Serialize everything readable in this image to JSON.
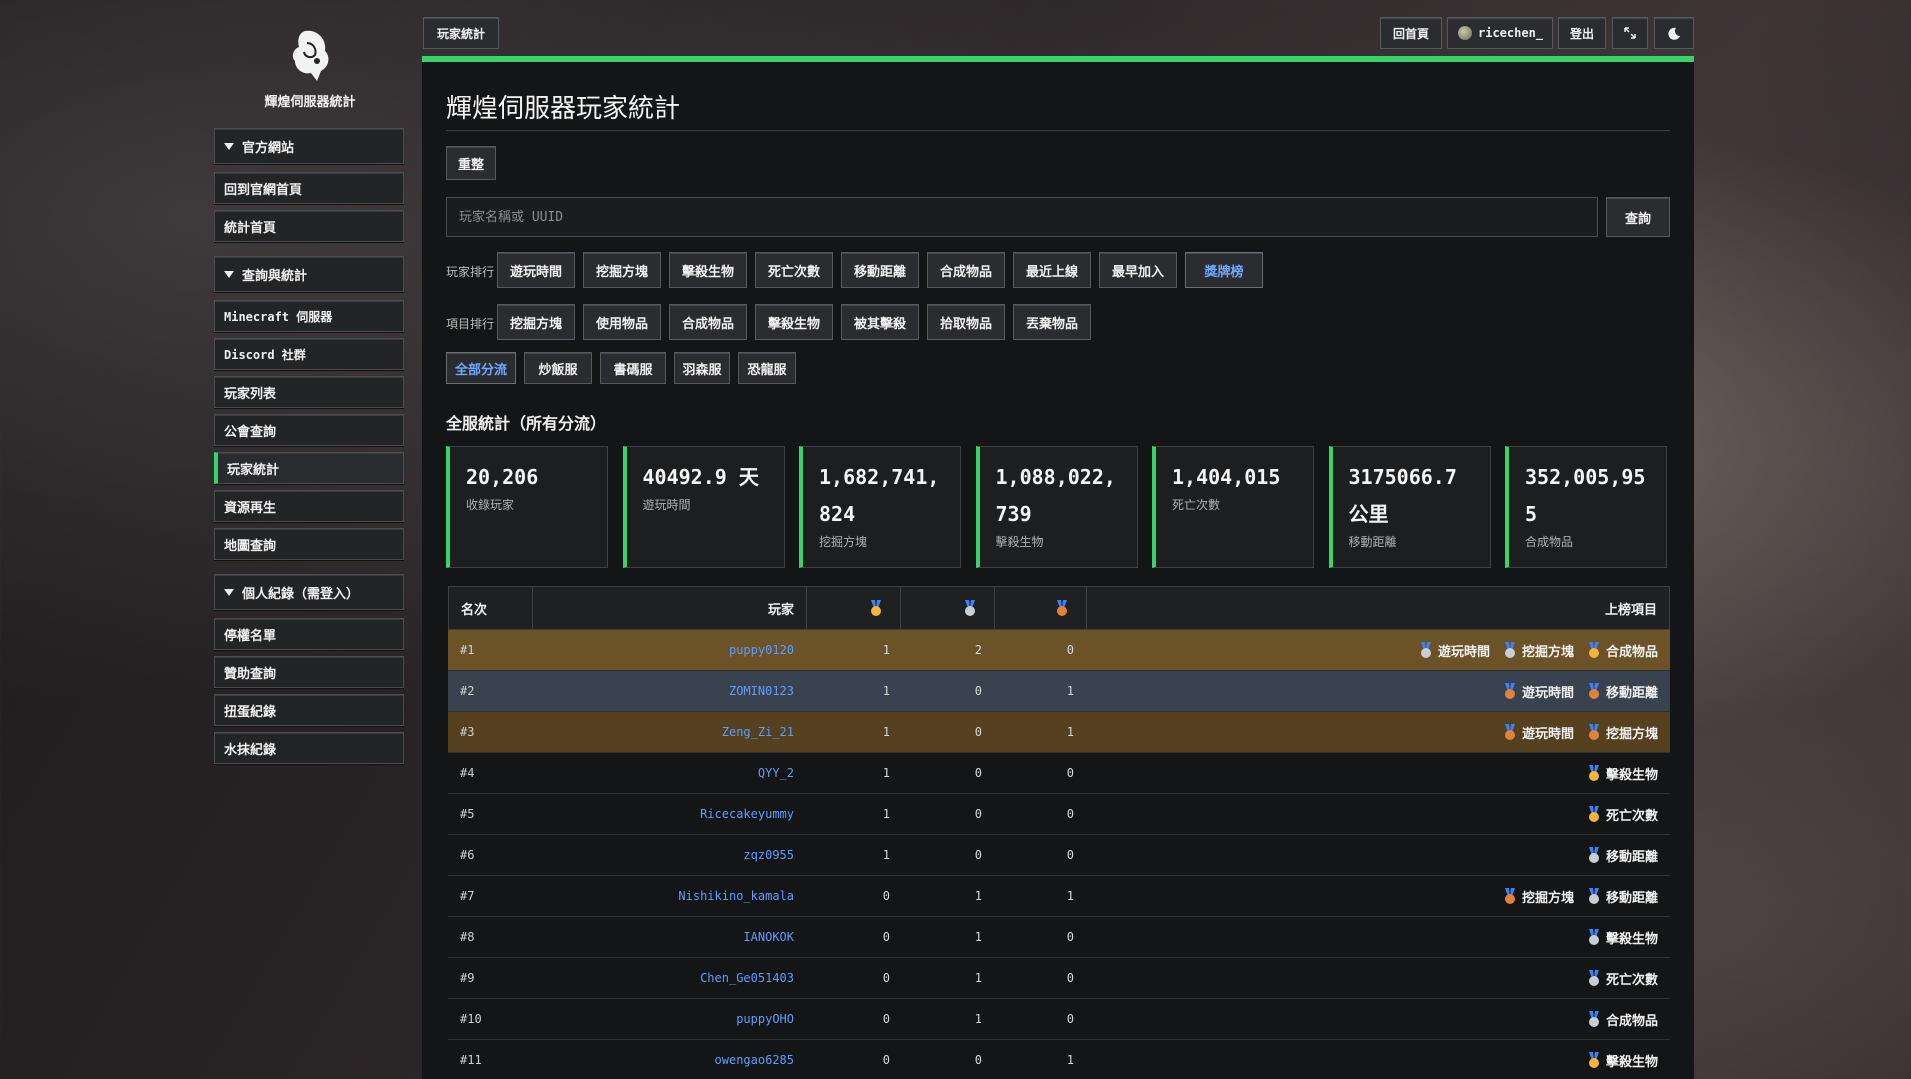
{
  "sidebar": {
    "logo_text": "輝煌伺服器統計",
    "groups": [
      {
        "title": "官方網站",
        "items": [
          "回到官網首頁",
          "統計首頁"
        ]
      },
      {
        "title": "查詢與統計",
        "items": [
          "Minecraft 伺服器",
          "Discord 社群",
          "玩家列表",
          "公會查詢",
          "玩家統計",
          "資源再生",
          "地圖查詢"
        ]
      },
      {
        "title": "個人紀錄（需登入）",
        "items": [
          "停權名單",
          "贊助查詢",
          "扭蛋紀錄",
          "水抹紀錄"
        ]
      }
    ]
  },
  "topbar": {
    "page_tab": "玩家統計",
    "home": "回首頁",
    "user": "ricechen_",
    "logout": "登出",
    "expand_icon": "expand-icon",
    "theme_icon": "moon-icon"
  },
  "main": {
    "title": "輝煌伺服器玩家統計",
    "reset": "重整",
    "search_placeholder": "玩家名稱或 UUID",
    "search_button": "查詢",
    "player_rank_label": "玩家排行",
    "player_rank_tabs": [
      "遊玩時間",
      "挖掘方塊",
      "擊殺生物",
      "死亡次數",
      "移動距離",
      "合成物品",
      "最近上線",
      "最早加入",
      "獎牌榜"
    ],
    "player_rank_selected": "獎牌榜",
    "item_rank_label": "項目排行",
    "item_rank_tabs": [
      "挖掘方塊",
      "使用物品",
      "合成物品",
      "擊殺生物",
      "被其擊殺",
      "拾取物品",
      "丟棄物品"
    ],
    "server_tabs": [
      "全部分流",
      "炒飯服",
      "書碼服",
      "羽森服",
      "恐龍服"
    ],
    "server_selected": "全部分流",
    "section_title": "全服統計（所有分流）",
    "stats": [
      {
        "value": "20,206",
        "label": "收錄玩家"
      },
      {
        "value": "40492.9 天",
        "label": "遊玩時間"
      },
      {
        "value": "1,682,741,824",
        "label": "挖掘方塊"
      },
      {
        "value": "1,088,022,739",
        "label": "擊殺生物"
      },
      {
        "value": "1,404,015",
        "label": "死亡次數"
      },
      {
        "value": "3175066.7 公里",
        "label": "移動距離"
      },
      {
        "value": "352,005,955",
        "label": "合成物品"
      }
    ],
    "table": {
      "headers": {
        "rank": "名次",
        "player": "玩家",
        "items": "上榜項目"
      },
      "rows": [
        {
          "rank": "#1",
          "player": "puppy0120",
          "gold": "1",
          "silver": "2",
          "bronze": "0",
          "tags": [
            {
              "m": "s",
              "t": "遊玩時間"
            },
            {
              "m": "s",
              "t": "挖掘方塊"
            },
            {
              "m": "g",
              "t": "合成物品"
            }
          ]
        },
        {
          "rank": "#2",
          "player": "ZOMIN0123",
          "gold": "1",
          "silver": "0",
          "bronze": "1",
          "tags": [
            {
              "m": "b",
              "t": "遊玩時間"
            },
            {
              "m": "b",
              "t": "移動距離"
            }
          ]
        },
        {
          "rank": "#3",
          "player": "Zeng_Zi_21",
          "gold": "1",
          "silver": "0",
          "bronze": "1",
          "tags": [
            {
              "m": "b",
              "t": "遊玩時間"
            },
            {
              "m": "b",
              "t": "挖掘方塊"
            }
          ]
        },
        {
          "rank": "#4",
          "player": "QYY_2",
          "gold": "1",
          "silver": "0",
          "bronze": "0",
          "tags": [
            {
              "m": "g",
              "t": "擊殺生物"
            }
          ]
        },
        {
          "rank": "#5",
          "player": "Ricecakeyummy",
          "gold": "1",
          "silver": "0",
          "bronze": "0",
          "tags": [
            {
              "m": "g",
              "t": "死亡次數"
            }
          ]
        },
        {
          "rank": "#6",
          "player": "zqz0955",
          "gold": "1",
          "silver": "0",
          "bronze": "0",
          "tags": [
            {
              "m": "s",
              "t": "移動距離"
            }
          ]
        },
        {
          "rank": "#7",
          "player": "Nishikino_kamala",
          "gold": "0",
          "silver": "1",
          "bronze": "1",
          "tags": [
            {
              "m": "b",
              "t": "挖掘方塊"
            },
            {
              "m": "s",
              "t": "移動距離"
            }
          ]
        },
        {
          "rank": "#8",
          "player": "IANOKOK",
          "gold": "0",
          "silver": "1",
          "bronze": "0",
          "tags": [
            {
              "m": "s",
              "t": "擊殺生物"
            }
          ]
        },
        {
          "rank": "#9",
          "player": "Chen_Ge051403",
          "gold": "0",
          "silver": "1",
          "bronze": "0",
          "tags": [
            {
              "m": "s",
              "t": "死亡次數"
            }
          ]
        },
        {
          "rank": "#10",
          "player": "puppyOHO",
          "gold": "0",
          "silver": "1",
          "bronze": "0",
          "tags": [
            {
              "m": "s",
              "t": "合成物品"
            }
          ]
        },
        {
          "rank": "#11",
          "player": "owengao6285",
          "gold": "0",
          "silver": "0",
          "bronze": "1",
          "tags": [
            {
              "m": "g",
              "t": "擊殺生物"
            }
          ]
        }
      ]
    }
  },
  "colors": {
    "accent": "#38d46b",
    "link": "#5f9dff",
    "gold_row": "#6b5227",
    "silver_row": "#394350",
    "bronze_row": "#55401f"
  }
}
